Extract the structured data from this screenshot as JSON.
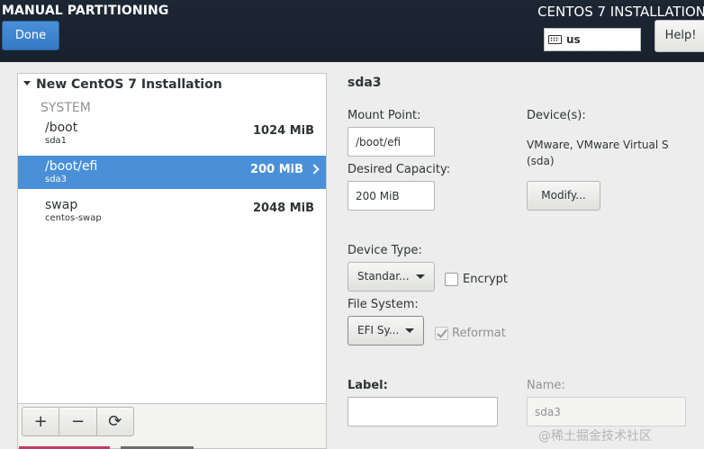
{
  "header": {
    "title": "MANUAL PARTITIONING",
    "done_label": "Done",
    "installer_title": "CENTOS 7 INSTALLATION",
    "keyboard_layout": "us",
    "help_label": "Help!"
  },
  "tree": {
    "title": "New CentOS 7 Installation",
    "group_label": "SYSTEM",
    "partitions": [
      {
        "name": "/boot",
        "device": "sda1",
        "size": "1024 MiB",
        "selected": false
      },
      {
        "name": "/boot/efi",
        "device": "sda3",
        "size": "200 MiB",
        "selected": true
      },
      {
        "name": "swap",
        "device": "centos-swap",
        "size": "2048 MiB",
        "selected": false
      }
    ]
  },
  "toolbar": {
    "add_label": "+",
    "remove_label": "−",
    "refresh_label": "⟳"
  },
  "details": {
    "title": "sda3",
    "mount_point_label": "Mount Point:",
    "mount_point_value": "/boot/efi",
    "capacity_label": "Desired Capacity:",
    "capacity_value": "200 MiB",
    "devices_label": "Device(s):",
    "devices_line1": "VMware, VMware Virtual S",
    "devices_line2": "(sda)",
    "modify_label": "Modify...",
    "device_type_label": "Device Type:",
    "device_type_value": "Standar...",
    "encrypt_label": "Encrypt",
    "file_system_label": "File System:",
    "file_system_value": "EFI Sy...",
    "reformat_label": "Reformat",
    "label_label": "Label:",
    "label_value": "",
    "name_label": "Name:",
    "name_value": "sda3"
  },
  "watermark": "@稀土掘金技术社区"
}
